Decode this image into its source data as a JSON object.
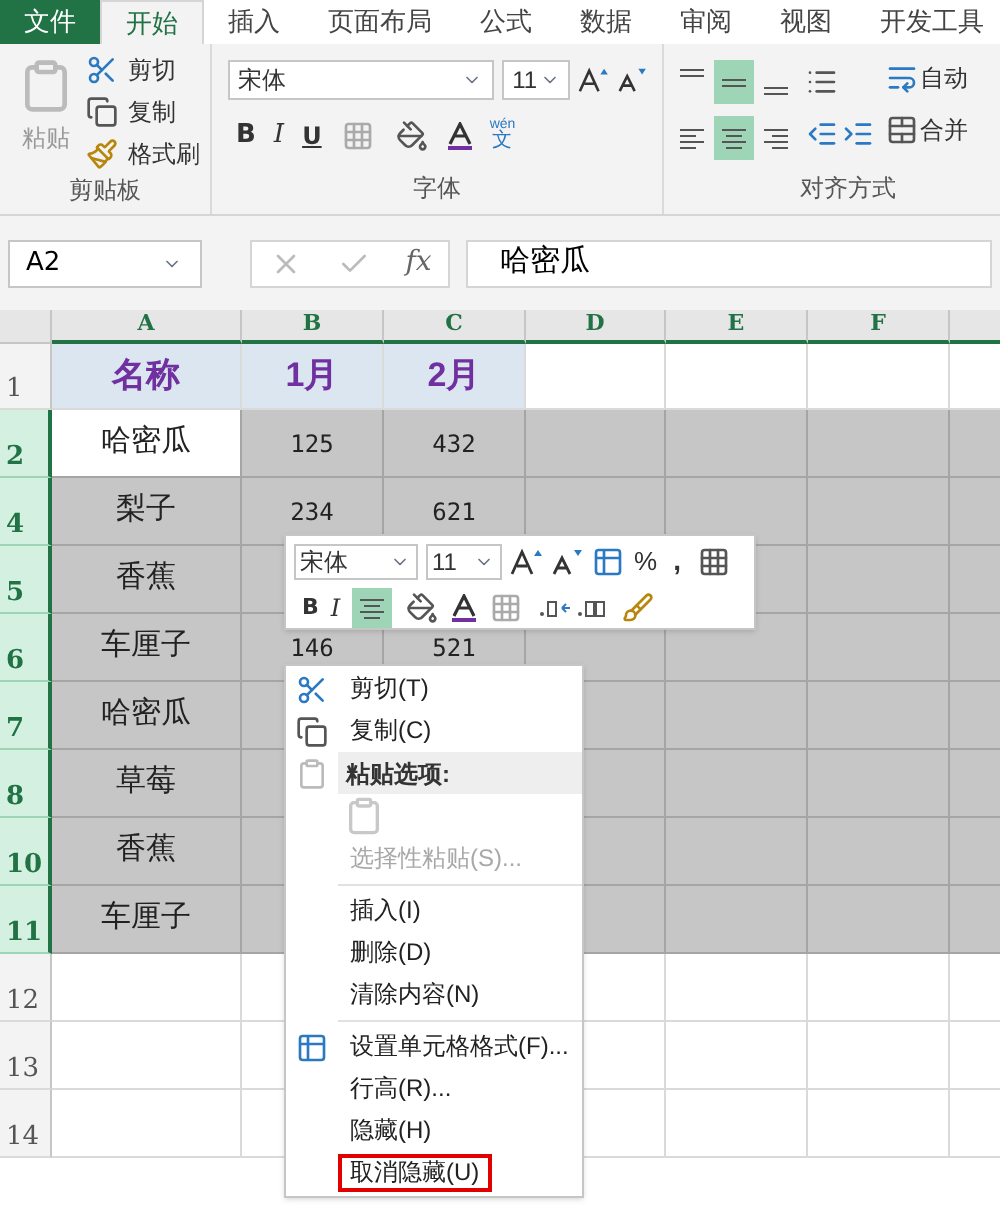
{
  "tabs": [
    {
      "label": "文件",
      "kind": "file",
      "selected": false
    },
    {
      "label": "开始",
      "kind": "tab",
      "selected": true
    },
    {
      "label": "插入",
      "kind": "tab",
      "selected": false
    },
    {
      "label": "页面布局",
      "kind": "tab",
      "selected": false
    },
    {
      "label": "公式",
      "kind": "tab",
      "selected": false
    },
    {
      "label": "数据",
      "kind": "tab",
      "selected": false
    },
    {
      "label": "审阅",
      "kind": "tab",
      "selected": false
    },
    {
      "label": "视图",
      "kind": "tab",
      "selected": false
    },
    {
      "label": "开发工具",
      "kind": "tab",
      "selected": false
    }
  ],
  "ribbon": {
    "clipboard": {
      "paste": "粘贴",
      "cut": "剪切",
      "copy": "复制",
      "format_painter": "格式刷",
      "label": "剪贴板"
    },
    "font": {
      "font_name": "宋体",
      "font_size": "11",
      "bold": "B",
      "italic": "I",
      "underline": "U",
      "phonetic_top": "wén",
      "phonetic_bottom": "文",
      "label": "字体"
    },
    "alignment": {
      "vertical": [
        {
          "kind": "top",
          "selected": false
        },
        {
          "kind": "middle",
          "selected": true
        },
        {
          "kind": "bottom",
          "selected": false
        }
      ],
      "horizontal": [
        {
          "kind": "left",
          "selected": false
        },
        {
          "kind": "center",
          "selected": true
        },
        {
          "kind": "right",
          "selected": false
        }
      ],
      "wrap": "自动",
      "merge": "合并",
      "label": "对齐方式"
    }
  },
  "name_box": "A2",
  "function_label": "fx",
  "formula": "哈密瓜",
  "columns": [
    "A",
    "B",
    "C",
    "D",
    "E",
    "F"
  ],
  "rows": [
    {
      "number": "1",
      "kind": "header",
      "selected": false,
      "active": false,
      "cells": [
        "名称",
        "1月",
        "2月"
      ]
    },
    {
      "number": "2",
      "kind": "data",
      "selected": true,
      "active": true,
      "cells": [
        "哈密瓜",
        "125",
        "432"
      ]
    },
    {
      "number": "4",
      "kind": "data",
      "selected": true,
      "active": false,
      "cells": [
        "梨子",
        "234",
        "621"
      ]
    },
    {
      "number": "5",
      "kind": "data",
      "selected": true,
      "active": false,
      "cells": [
        "香蕉"
      ]
    },
    {
      "number": "6",
      "kind": "data",
      "selected": true,
      "active": false,
      "cells": [
        "车厘子",
        "146",
        "521"
      ]
    },
    {
      "number": "7",
      "kind": "data",
      "selected": true,
      "active": false,
      "cells": [
        "哈密瓜"
      ]
    },
    {
      "number": "8",
      "kind": "data",
      "selected": true,
      "active": false,
      "cells": [
        "草莓"
      ]
    },
    {
      "number": "10",
      "kind": "data",
      "selected": true,
      "active": false,
      "cells": [
        "香蕉"
      ]
    },
    {
      "number": "11",
      "kind": "data",
      "selected": true,
      "active": false,
      "cells": [
        "车厘子"
      ]
    },
    {
      "number": "12",
      "kind": "data",
      "selected": false,
      "active": false
    },
    {
      "number": "13",
      "kind": "data",
      "selected": false,
      "active": false
    },
    {
      "number": "14",
      "kind": "data",
      "selected": false,
      "active": false
    }
  ],
  "mini_toolbar": {
    "font_name": "宋体",
    "font_size": "11",
    "percent": "%",
    "comma": ",",
    "bold": "B",
    "italic": "I",
    "align_center_selected": true
  },
  "context_menu": [
    {
      "kind": "item",
      "label": "剪切(T)",
      "disabled": false,
      "highlighted": false
    },
    {
      "kind": "item",
      "label": "复制(C)",
      "disabled": false,
      "highlighted": false
    },
    {
      "kind": "header",
      "label": "粘贴选项:"
    },
    {
      "kind": "paste_icon",
      "disabled": true
    },
    {
      "kind": "item",
      "label": "选择性粘贴(S)...",
      "disabled": true,
      "highlighted": false
    },
    {
      "kind": "separator"
    },
    {
      "kind": "item",
      "label": "插入(I)",
      "disabled": false,
      "highlighted": false
    },
    {
      "kind": "item",
      "label": "删除(D)",
      "disabled": false,
      "highlighted": false
    },
    {
      "kind": "item",
      "label": "清除内容(N)",
      "disabled": false,
      "highlighted": false
    },
    {
      "kind": "separator"
    },
    {
      "kind": "item",
      "label": "设置单元格格式(F)...",
      "disabled": false,
      "highlighted": false
    },
    {
      "kind": "item",
      "label": "行高(R)...",
      "disabled": false,
      "highlighted": false
    },
    {
      "kind": "item",
      "label": "隐藏(H)",
      "disabled": false,
      "highlighted": false
    },
    {
      "kind": "item",
      "label": "取消隐藏(U)",
      "disabled": false,
      "highlighted": true
    }
  ]
}
